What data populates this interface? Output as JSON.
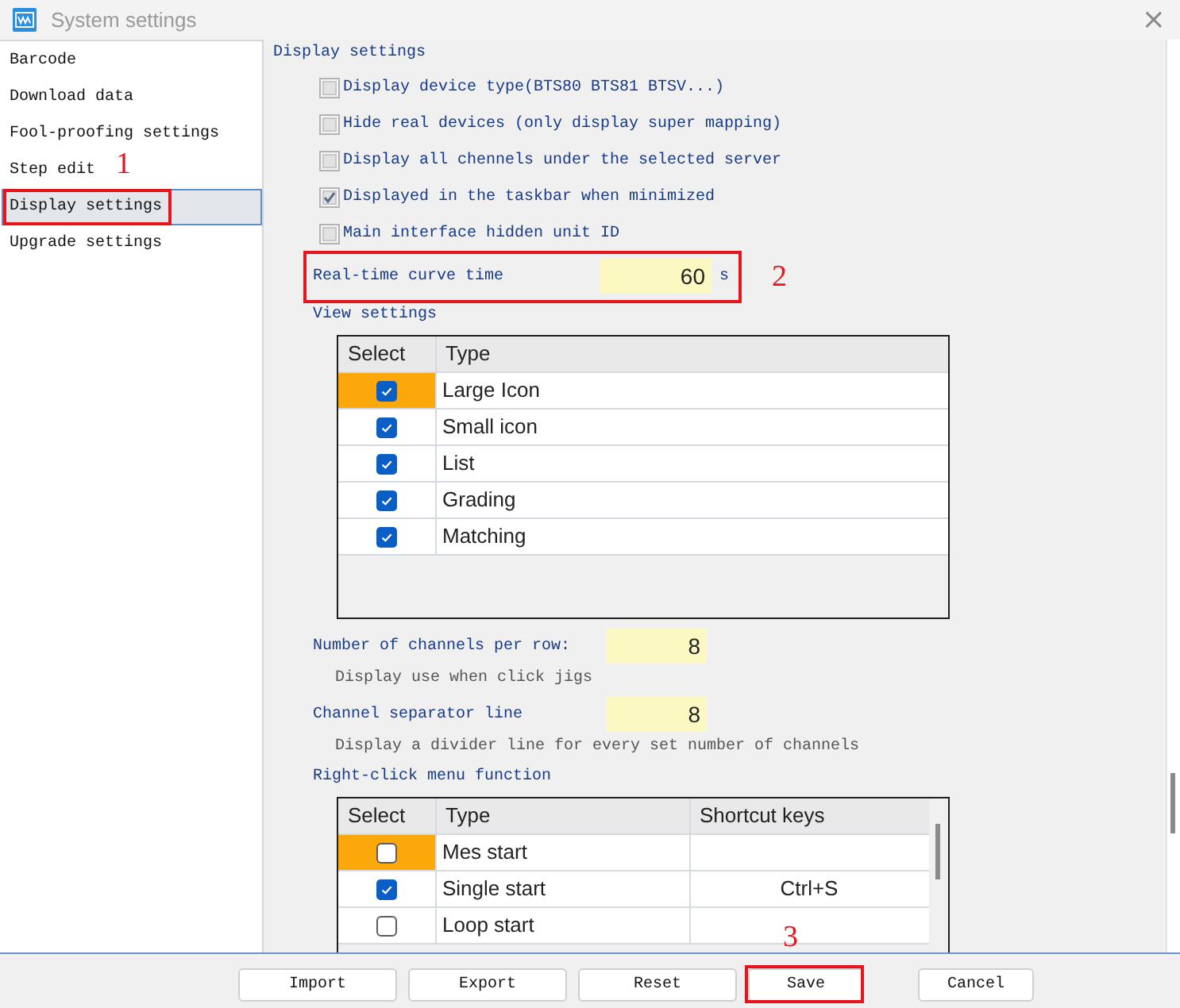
{
  "window": {
    "title": "System settings",
    "close": "×"
  },
  "sidebar": {
    "items": [
      {
        "label": "Barcode",
        "selected": false
      },
      {
        "label": "Download data",
        "selected": false
      },
      {
        "label": "Fool-proofing settings",
        "selected": false
      },
      {
        "label": "Step edit",
        "selected": false
      },
      {
        "label": "Display settings",
        "selected": true,
        "callout": "1"
      },
      {
        "label": "Upgrade settings",
        "selected": false
      }
    ]
  },
  "panel": {
    "title": "Display settings",
    "options": [
      {
        "label": "Display device type(BTS80 BTS81 BTSV...)",
        "checked": false
      },
      {
        "label": "Hide real devices (only display super mapping)",
        "checked": false
      },
      {
        "label": "Display all chennels under the selected server",
        "checked": false
      },
      {
        "label": "Displayed in the taskbar when minimized",
        "checked": true
      },
      {
        "label": "Main interface hidden unit ID",
        "checked": false
      }
    ],
    "curve_time": {
      "label": "Real-time curve time",
      "value": "60",
      "unit": "s",
      "callout": "2"
    },
    "view_settings": {
      "title": "View settings",
      "columns": [
        "Select",
        "Type"
      ],
      "rows": [
        {
          "checked": true,
          "selected": true,
          "type": "Large Icon"
        },
        {
          "checked": true,
          "selected": false,
          "type": "Small icon"
        },
        {
          "checked": true,
          "selected": false,
          "type": "List"
        },
        {
          "checked": true,
          "selected": false,
          "type": "Grading"
        },
        {
          "checked": true,
          "selected": false,
          "type": "Matching"
        }
      ]
    },
    "channels_per_row": {
      "label": "Number of channels per row:",
      "value": "8",
      "hint": "Display use when click jigs"
    },
    "separator_line": {
      "label": "Channel separator line",
      "value": "8",
      "hint": "Display a divider line for every set number of channels"
    },
    "right_click_menu": {
      "title": "Right-click menu function",
      "columns": [
        "Select",
        "Type",
        "Shortcut keys"
      ],
      "rows": [
        {
          "checked": false,
          "selected": true,
          "type": "Mes start"
        },
        {
          "checked": true,
          "selected": false,
          "type": "Single start",
          "shortcut": "Ctrl+S"
        },
        {
          "checked": false,
          "selected": false,
          "type": "Loop start"
        }
      ]
    }
  },
  "buttons": [
    {
      "label": "Import"
    },
    {
      "label": "Export"
    },
    {
      "label": "Reset"
    },
    {
      "label": "Save",
      "callout": "3"
    },
    {
      "label": "Cancel"
    }
  ]
}
